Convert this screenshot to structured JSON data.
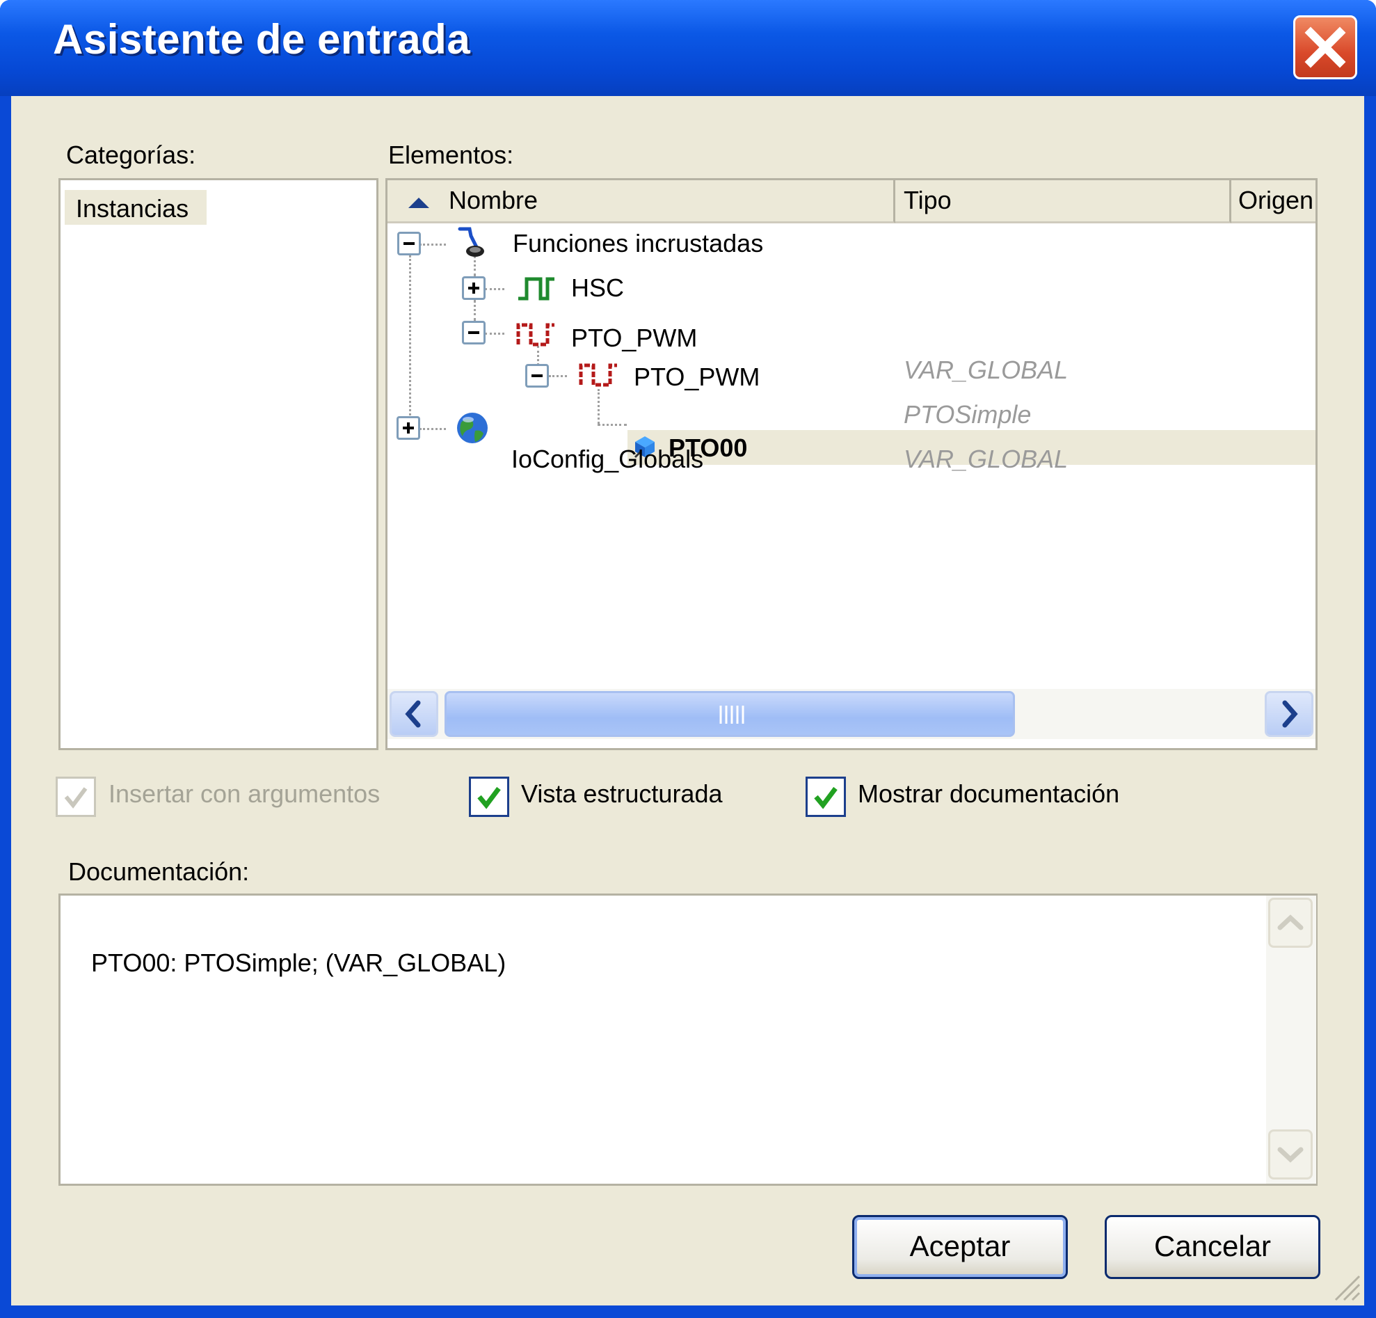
{
  "window": {
    "title": "Asistente de entrada",
    "close_icon": "close-x-icon"
  },
  "categories": {
    "label": "Categorías:",
    "items": [
      {
        "label": "Instancias",
        "selected": true
      }
    ]
  },
  "elements": {
    "label": "Elementos:",
    "columns": {
      "name": "Nombre",
      "type": "Tipo",
      "origin": "Origen"
    },
    "sort": "ascending",
    "tree": {
      "functions": {
        "label": "Funciones incrustadas",
        "expanded": true,
        "icon": "embedded-functions-icon"
      },
      "hsc": {
        "label": "HSC",
        "expanded": false,
        "icon": "pulse-green-icon"
      },
      "pto_pwm_group": {
        "label": "PTO_PWM",
        "expanded": true,
        "icon": "pulse-red-icon"
      },
      "pto_pwm_var": {
        "label": "PTO_PWM",
        "type": "VAR_GLOBAL",
        "expanded": true,
        "icon": "pulse-red-icon"
      },
      "pto00": {
        "label": "PTO00",
        "type": "PTOSimple",
        "selected": true,
        "icon": "instance-cube-icon"
      },
      "ioconfig": {
        "label": "IoConfig_Globals",
        "type": "VAR_GLOBAL",
        "expanded": false,
        "icon": "globe-icon"
      }
    }
  },
  "options": {
    "insert_args": {
      "label": "Insertar con argumentos",
      "checked": true,
      "enabled": false
    },
    "structured_view": {
      "label": "Vista estructurada",
      "checked": true,
      "enabled": true
    },
    "show_docs": {
      "label": "Mostrar documentación",
      "checked": true,
      "enabled": true
    }
  },
  "documentation": {
    "label": "Documentación:",
    "text": "PTO00: PTOSimple; (VAR_GLOBAL)"
  },
  "buttons": {
    "ok": "Aceptar",
    "cancel": "Cancelar"
  },
  "colors": {
    "titlebar": "#0b58e6",
    "dialog_bg": "#ece9d8",
    "close": "#d9492a",
    "check": "#21a121"
  }
}
